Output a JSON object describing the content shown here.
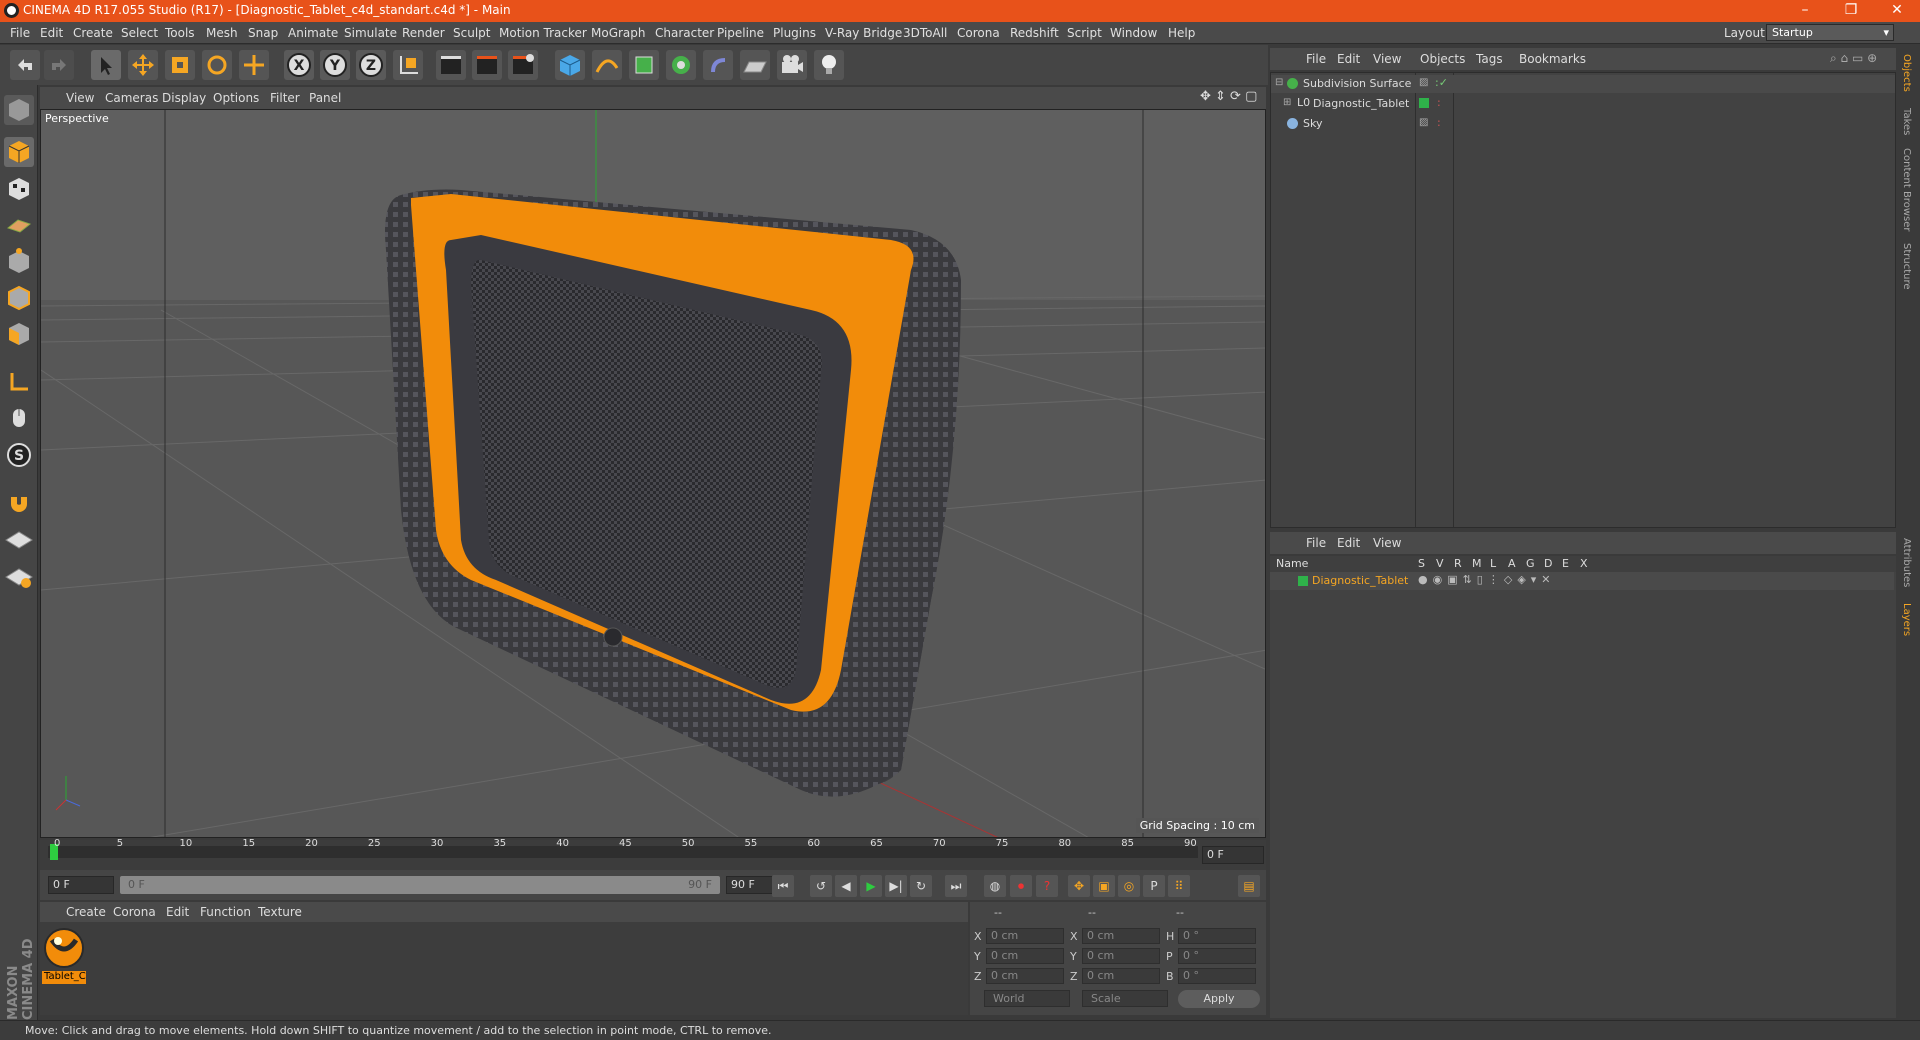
{
  "window": {
    "title": "CINEMA 4D R17.055 Studio (R17) - [Diagnostic_Tablet_c4d_standart.c4d *] - Main",
    "controls": [
      "–",
      "❐",
      "✕"
    ]
  },
  "menubar": {
    "items": [
      "File",
      "Edit",
      "Create",
      "Select",
      "Tools",
      "Mesh",
      "Snap",
      "Animate",
      "Simulate",
      "Render",
      "Sculpt",
      "Motion Tracker",
      "MoGraph",
      "Character",
      "Pipeline",
      "Plugins",
      "V-Ray Bridge",
      "3DToAll",
      "Corona",
      "Redshift",
      "Script",
      "Window",
      "Help"
    ],
    "layout_label": "Layout:",
    "layout_value": "Startup"
  },
  "viewport": {
    "menu": [
      "View",
      "Cameras",
      "Display",
      "Options",
      "Filter",
      "Panel"
    ],
    "label": "Perspective",
    "grid_spacing": "Grid Spacing : 10 cm"
  },
  "timeline": {
    "ticks": [
      "0",
      "5",
      "10",
      "15",
      "20",
      "25",
      "30",
      "35",
      "40",
      "45",
      "50",
      "55",
      "60",
      "65",
      "70",
      "75",
      "80",
      "85",
      "90"
    ],
    "current_frame": "0 F",
    "start_field": "0 F",
    "range_start": "0 F",
    "range_end": "90 F",
    "end_field": "90 F"
  },
  "material_manager": {
    "menu": [
      "Create",
      "Corona",
      "Edit",
      "Function",
      "Texture"
    ],
    "materials": [
      {
        "label": "Tablet_C"
      }
    ]
  },
  "coordinates": {
    "headers": [
      "--",
      "--",
      "--"
    ],
    "rows": [
      {
        "a": "X",
        "av": "0 cm",
        "b": "X",
        "bv": "0 cm",
        "c": "H",
        "cv": "0 °"
      },
      {
        "a": "Y",
        "av": "0 cm",
        "b": "Y",
        "bv": "0 cm",
        "c": "P",
        "cv": "0 °"
      },
      {
        "a": "Z",
        "av": "0 cm",
        "b": "Z",
        "bv": "0 cm",
        "c": "B",
        "cv": "0 °"
      }
    ],
    "mode1": "World",
    "mode2": "Scale",
    "apply": "Apply"
  },
  "status": "Move: Click and drag to move elements. Hold down SHIFT to quantize movement / add to the selection in point mode, CTRL to remove.",
  "object_manager": {
    "menu": [
      "File",
      "Edit",
      "View",
      "Objects",
      "Tags",
      "Bookmarks"
    ],
    "objects": [
      {
        "name": "Subdivision Surface",
        "icon_color": "#46b04a"
      },
      {
        "name": "Diagnostic_Tablet",
        "icon_color": "#d0d0d0"
      },
      {
        "name": "Sky",
        "icon_color": "#8ab4e0"
      }
    ]
  },
  "layer_manager": {
    "menu": [
      "File",
      "Edit",
      "View"
    ],
    "columns": [
      "Name",
      "S",
      "V",
      "R",
      "M",
      "L",
      "A",
      "G",
      "D",
      "E",
      "X"
    ],
    "layers": [
      {
        "name": "Diagnostic_Tablet",
        "color": "#2fb24a"
      }
    ]
  },
  "side_tabs": [
    "Objects",
    "Takes",
    "Content Browser",
    "Structure",
    "Attributes",
    "Layers"
  ],
  "brand": "MAXON CINEMA 4D",
  "colors": {
    "accent": "#e8521a",
    "tablet": "#f28c0a"
  }
}
